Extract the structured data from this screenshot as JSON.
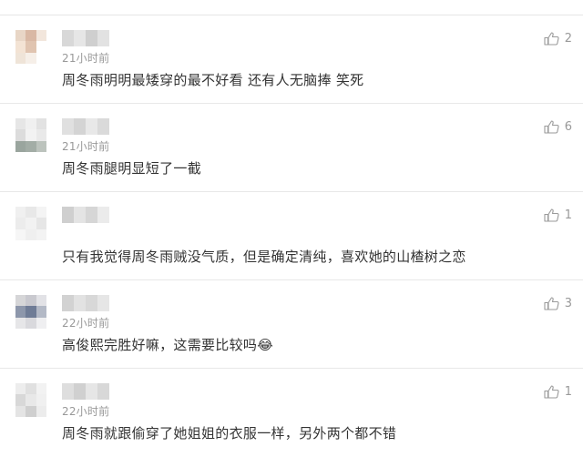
{
  "comments": [
    {
      "time": "21小时前",
      "text": "周冬雨明明最矮穿的最不好看 还有人无脑捧 笑死",
      "likes": "2",
      "avatar_colors": [
        "#e8d6c6",
        "#d9b8a4",
        "#f2e6dc",
        "#f3e3d4",
        "#e0c4b0",
        "#ffffff",
        "#efe4d8",
        "#f6efe8",
        "#ffffff"
      ],
      "name_colors": [
        "#d8d8d8",
        "#e6e6e6",
        "#cfcfcf",
        "#e2e2e2"
      ]
    },
    {
      "time": "21小时前",
      "text": "周冬雨腿明显短了一截",
      "likes": "6",
      "avatar_colors": [
        "#e6e6e6",
        "#f0f0f0",
        "#e2e2e2",
        "#dcdcdc",
        "#f2f2f2",
        "#e9e9e9",
        "#9aa59e",
        "#a3ada6",
        "#bcc3bd"
      ],
      "name_colors": [
        "#e0e0e0",
        "#d4d4d4",
        "#e8e8e8",
        "#dadada"
      ]
    },
    {
      "time": "",
      "text": "只有我觉得周冬雨贼没气质，但是确定清纯，喜欢她的山楂树之恋",
      "likes": "1",
      "avatar_colors": [
        "#f0f0f0",
        "#e8e8e8",
        "#f4f4f4",
        "#ececec",
        "#f2f2f2",
        "#e6e6e6",
        "#f6f6f6",
        "#efefef",
        "#f3f3f3"
      ],
      "name_colors": [
        "#cfcfcf",
        "#e4e4e4",
        "#d6d6d6",
        "#ebebeb"
      ]
    },
    {
      "time": "22小时前",
      "text": "高俊熙完胜好嘛，这需要比较吗😂",
      "likes": "3",
      "avatar_colors": [
        "#d6d6d8",
        "#c9c9cf",
        "#e2e2e6",
        "#8d97ab",
        "#6f7c96",
        "#b3b9c6",
        "#e6e6e8",
        "#d9d9dd",
        "#efeff1"
      ],
      "name_colors": [
        "#d2d2d2",
        "#e2e2e2",
        "#d8d8d8",
        "#e6e6e6"
      ]
    },
    {
      "time": "22小时前",
      "text": "周冬雨就跟偷穿了她姐姐的衣服一样，另外两个都不错",
      "likes": "1",
      "avatar_colors": [
        "#ededed",
        "#e0e0e0",
        "#f2f2f2",
        "#d8d8d8",
        "#e8e8e8",
        "#f0f0f0",
        "#e4e4e4",
        "#cfcfcf",
        "#ececec"
      ],
      "name_colors": [
        "#dedede",
        "#d0d0d0",
        "#e6e6e6",
        "#d8d8d8"
      ]
    }
  ]
}
